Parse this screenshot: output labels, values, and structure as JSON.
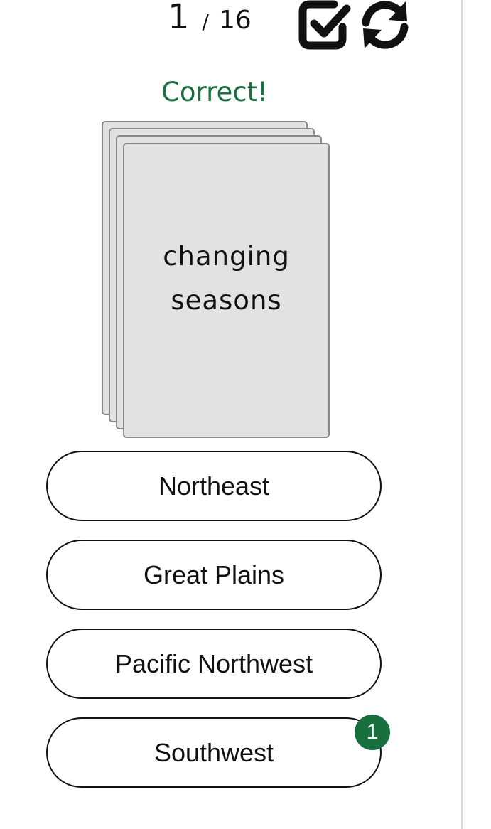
{
  "progress": {
    "current": "1",
    "separator": "/",
    "total": "16"
  },
  "toolbar": {
    "check_icon": "checkbox-check-icon",
    "refresh_icon": "refresh-icon"
  },
  "feedback": {
    "text": "Correct!",
    "color": "#1a7040"
  },
  "card": {
    "text": "changing seasons"
  },
  "options": [
    {
      "label": "Northeast"
    },
    {
      "label": "Great Plains"
    },
    {
      "label": "Pacific Northwest"
    },
    {
      "label": "Southwest",
      "badge": "1"
    }
  ],
  "colors": {
    "card_background": "#e2e2e2",
    "badge": "#17703e"
  }
}
